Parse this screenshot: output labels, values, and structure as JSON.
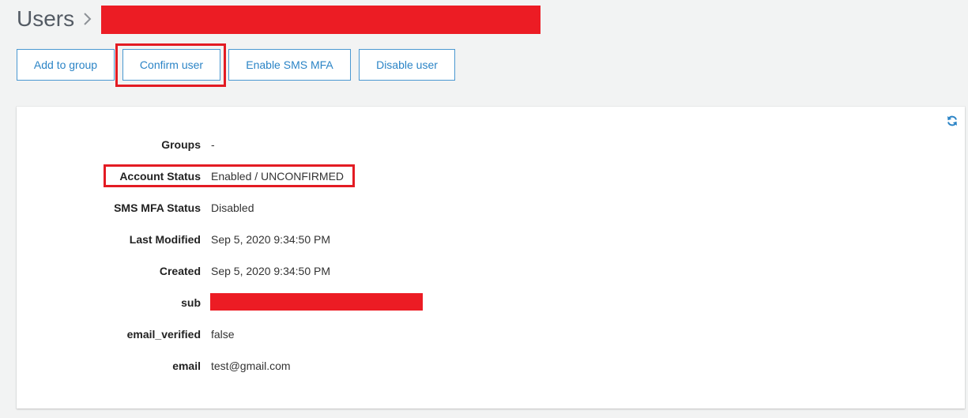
{
  "breadcrumb": {
    "root": "Users",
    "separator_icon": "chevron-right-icon"
  },
  "actions": {
    "add_to_group": "Add to group",
    "confirm_user": "Confirm user",
    "enable_sms_mfa": "Enable SMS MFA",
    "disable_user": "Disable user"
  },
  "details": {
    "refresh_icon": "refresh-icon",
    "rows": [
      {
        "label": "Groups",
        "value": "-"
      },
      {
        "label": "Account Status",
        "value": "Enabled / UNCONFIRMED"
      },
      {
        "label": "SMS MFA Status",
        "value": "Disabled"
      },
      {
        "label": "Last Modified",
        "value": "Sep 5, 2020 9:34:50 PM"
      },
      {
        "label": "Created",
        "value": "Sep 5, 2020 9:34:50 PM"
      },
      {
        "label": "sub",
        "value": ""
      },
      {
        "label": "email_verified",
        "value": "false"
      },
      {
        "label": "email",
        "value": "test@gmail.com"
      }
    ]
  },
  "colors": {
    "accent": "#2b84c6",
    "highlight": "#e31b23",
    "redaction": "#ec1c24"
  }
}
